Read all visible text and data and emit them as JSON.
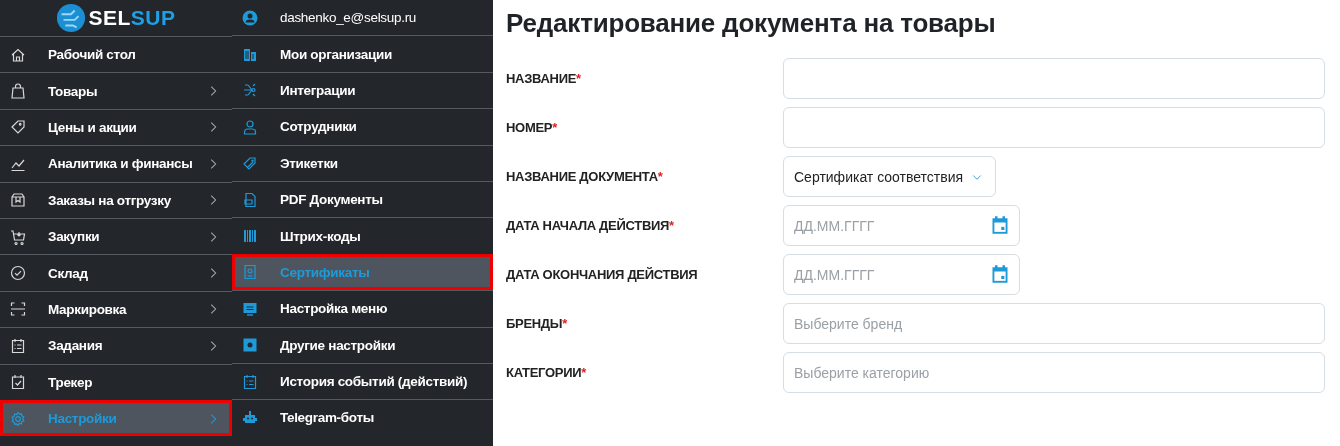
{
  "logo": {
    "text_a": "SEL",
    "text_b": "SUP"
  },
  "sidebar": {
    "items": [
      {
        "label": "Рабочий стол",
        "has_submenu": false,
        "selected": false,
        "highlighted": false
      },
      {
        "label": "Товары",
        "has_submenu": true,
        "selected": false,
        "highlighted": false
      },
      {
        "label": "Цены и акции",
        "has_submenu": true,
        "selected": false,
        "highlighted": false
      },
      {
        "label": "Аналитика и финансы",
        "has_submenu": true,
        "selected": false,
        "highlighted": false
      },
      {
        "label": "Заказы на отгрузку",
        "has_submenu": true,
        "selected": false,
        "highlighted": false
      },
      {
        "label": "Закупки",
        "has_submenu": true,
        "selected": false,
        "highlighted": false
      },
      {
        "label": "Склад",
        "has_submenu": true,
        "selected": false,
        "highlighted": false
      },
      {
        "label": "Маркировка",
        "has_submenu": true,
        "selected": false,
        "highlighted": false
      },
      {
        "label": "Задания",
        "has_submenu": true,
        "selected": false,
        "highlighted": false
      },
      {
        "label": "Трекер",
        "has_submenu": false,
        "selected": false,
        "highlighted": false
      },
      {
        "label": "Настройки",
        "has_submenu": true,
        "selected": true,
        "highlighted": true
      }
    ]
  },
  "submenu": {
    "user": "dashenko_e@selsup.ru",
    "items": [
      {
        "label": "Мои организации",
        "selected": false,
        "highlighted": false
      },
      {
        "label": "Интеграции",
        "selected": false,
        "highlighted": false
      },
      {
        "label": "Сотрудники",
        "selected": false,
        "highlighted": false
      },
      {
        "label": "Этикетки",
        "selected": false,
        "highlighted": false
      },
      {
        "label": "PDF Документы",
        "selected": false,
        "highlighted": false
      },
      {
        "label": "Штрих-коды",
        "selected": false,
        "highlighted": false
      },
      {
        "label": "Сертификаты",
        "selected": true,
        "highlighted": true
      },
      {
        "label": "Настройка меню",
        "selected": false,
        "highlighted": false
      },
      {
        "label": "Другие настройки",
        "selected": false,
        "highlighted": false
      },
      {
        "label": "История событий (действий)",
        "selected": false,
        "highlighted": false
      },
      {
        "label": "Telegram-боты",
        "selected": false,
        "highlighted": false
      }
    ]
  },
  "form": {
    "title": "Редактирование документа на товары",
    "fields": [
      {
        "label": "НАЗВАНИЕ",
        "required_mark": "*",
        "kind": "text"
      },
      {
        "label": "НОМЕР",
        "required_mark": "*",
        "kind": "text"
      },
      {
        "label": "НАЗВАНИЕ ДОКУМЕНТА",
        "required_mark": "*",
        "kind": "select",
        "value": "Сертификат соответствия"
      },
      {
        "label": "ДАТА НАЧАЛА ДЕЙСТВИЯ",
        "required_mark": "*",
        "kind": "date",
        "placeholder": "ДД.ММ.ГГГГ"
      },
      {
        "label": "ДАТА ОКОНЧАНИЯ ДЕЙСТВИЯ",
        "kind": "date",
        "placeholder": "ДД.ММ.ГГГГ"
      },
      {
        "label": "БРЕНДЫ",
        "required_mark": "*",
        "kind": "text",
        "placeholder": "Выберите бренд"
      },
      {
        "label": "КАТЕГОРИИ",
        "required_mark": "*",
        "kind": "text",
        "placeholder": "Выберите категорию"
      }
    ]
  }
}
